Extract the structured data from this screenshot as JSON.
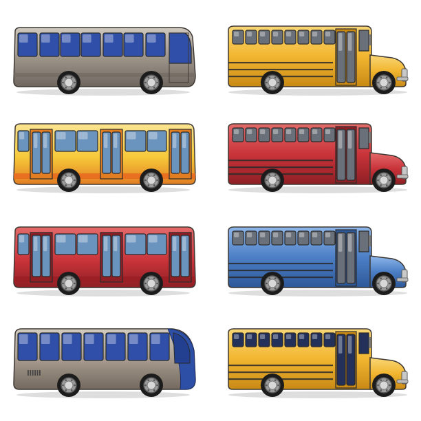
{
  "buses": [
    {
      "kind": "coach",
      "body": "#9e958b",
      "shade": "#6f675f",
      "light": "#cfc8bf",
      "window": "#2f4fa8",
      "accent": "#8c8278"
    },
    {
      "kind": "school",
      "body": "#f2b630",
      "shade": "#c98a16",
      "light": "#f9d777",
      "window": "#6a7079",
      "accent": "#2a2a2a"
    },
    {
      "kind": "city",
      "body": "#f7c93a",
      "shade": "#e27d22",
      "light": "#fbe592",
      "window": "#6a93bd",
      "accent": "#e86a1e"
    },
    {
      "kind": "school",
      "body": "#c9343a",
      "shade": "#8e1f24",
      "light": "#e46a6a",
      "window": "#6a7079",
      "accent": "#2a2a2a"
    },
    {
      "kind": "city",
      "body": "#c9343a",
      "shade": "#8e1f24",
      "light": "#e46a6a",
      "window": "#6a93bd",
      "accent": "#9a1e24"
    },
    {
      "kind": "school",
      "body": "#4c7fc6",
      "shade": "#2d5898",
      "light": "#8eb6ea",
      "window": "#6a7079",
      "accent": "#2a2a2a"
    },
    {
      "kind": "modern-coach",
      "body": "#a69b8e",
      "shade": "#74695e",
      "light": "#d3cbc0",
      "window": "#2f4fa8",
      "accent": "#2d4fa6"
    },
    {
      "kind": "school",
      "body": "#f2b630",
      "shade": "#c98a16",
      "light": "#f9d777",
      "window": "#23305a",
      "accent": "#2a2a2a"
    }
  ]
}
